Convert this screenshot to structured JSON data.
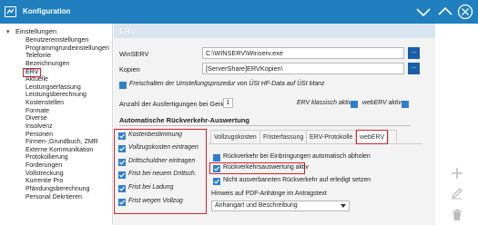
{
  "window": {
    "title": "Konfiguration"
  },
  "tree": {
    "root": "Einstellungen",
    "items": [
      "Benutzereinstellungen",
      "Programmgrundeinstellungen",
      "Telefonie",
      "Bezeichnungen",
      "ERV",
      "Aktuelle",
      "Leistungserfassung",
      "Leistungsberechnung",
      "Kostenstellen",
      "Formate",
      "Diverse",
      "Insolvenz",
      "Personen",
      "Firmen-,Grundbuch, ZMR",
      "Externe Kommunikation",
      "Protokollierung",
      "Forderungen",
      "Vollstreckung",
      "Kurrentie Pro",
      "Pfändungsberechnung",
      "Personal Dekrtieren"
    ],
    "selected_index": 4
  },
  "panel": {
    "header": "ERV",
    "winserv_label": "WinSERV",
    "winserv_value": "C:\\WINSERV\\Winserv.exe",
    "kopien_label": "Kopien",
    "kopien_value": "[ServerShare]ERVKopien\\",
    "browse_label": "...",
    "freischalten_label": "Freischalten der Umstellungsprozedur von ÜSt HF-Data auf ÜSt Manz",
    "anzahl_label": "Anzahl der Ausfertigungen bei Gericht",
    "anzahl_value": "1",
    "erv_klassisch_label": "ERV klassisch aktiv",
    "webERV_aktiv_label": "webERV aktiv",
    "section_title": "Automatische Rückverkehr-Auswertung",
    "left_checks": [
      "Kostenbestimmung",
      "Vollzugskosten eintragen",
      "Drittschuldner eintragen",
      "Frist bei neuem Drittsch.",
      "Frist bei Ladung",
      "Frist wegen Vollzug"
    ],
    "tabs": [
      "Vollzugskosten",
      "Fristerfassung",
      "ERV-Protokolle",
      "webERV"
    ],
    "active_tab": "webERV",
    "tab_checks": [
      "Rückverkehr bei Einbringungen automatisch abholen",
      "Rückverkehrsauswertung aktiv",
      "Nicht ausverbannten Rückverkehr auf erledigt setzen"
    ],
    "pdf_label": "Hinweis auf PDF-Anhänge im Antragstext",
    "pdf_select": "Anhangart und Beschreibung"
  },
  "colors": {
    "titlebar": "#1f7fbf",
    "header": "#d9e5f0",
    "accent": "#2f7fd0",
    "highlight": "#e0202a"
  },
  "icons": [
    "settings-window-icon",
    "minimize-chevron-icon",
    "close-icon",
    "add-icon",
    "edit-pencil-icon",
    "delete-trash-icon"
  ]
}
